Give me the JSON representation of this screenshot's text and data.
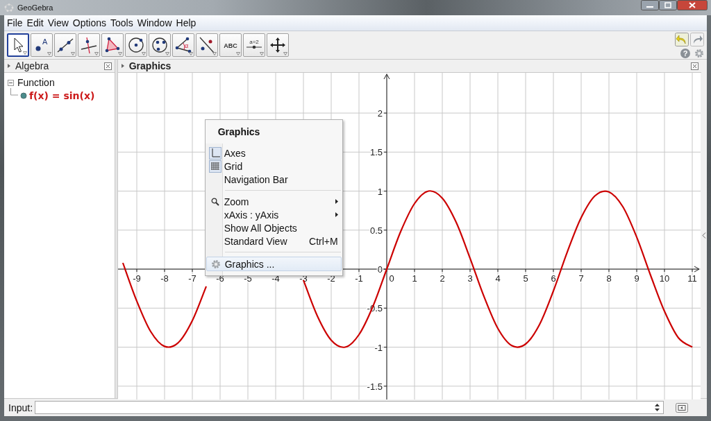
{
  "window": {
    "title": "GeoGebra"
  },
  "menu_bar": [
    "File",
    "Edit",
    "View",
    "Options",
    "Tools",
    "Window",
    "Help"
  ],
  "toolbar": {
    "tools": [
      {
        "kind": "move",
        "selected": true
      },
      {
        "kind": "point",
        "label": "A",
        "selected": false
      },
      {
        "kind": "line",
        "selected": false
      },
      {
        "kind": "perpendicular",
        "selected": false
      },
      {
        "kind": "polygon",
        "selected": false
      },
      {
        "kind": "circle",
        "selected": false
      },
      {
        "kind": "circle3",
        "selected": false
      },
      {
        "kind": "angle",
        "label": "α",
        "selected": false
      },
      {
        "kind": "reflect",
        "selected": false
      },
      {
        "kind": "text",
        "label": "ABC",
        "selected": false
      },
      {
        "kind": "slider",
        "label": "a=2",
        "selected": false
      },
      {
        "kind": "pan",
        "selected": false
      }
    ],
    "help": "?"
  },
  "algebra": {
    "title": "Algebra",
    "tree": [
      {
        "label": "Function",
        "expanded": true,
        "children": [
          {
            "label": "f(x) = sin(x)",
            "visible": true
          }
        ]
      }
    ]
  },
  "graphics": {
    "title": "Graphics",
    "chart_data": {
      "type": "line",
      "x": [
        -9.5,
        -9,
        -8.5,
        -8,
        -7.5,
        -7,
        -6.5,
        -6,
        -5.5,
        -5,
        -4.5,
        -4,
        -3.5,
        -3,
        -2.5,
        -2,
        -1.5,
        -1,
        -0.5,
        0,
        0.5,
        1,
        1.5,
        2,
        2.5,
        3,
        3.5,
        4,
        4.5,
        5,
        5.5,
        6,
        6.5,
        7,
        7.5,
        8,
        8.5,
        9,
        9.5,
        10,
        10.5,
        11
      ],
      "series": [
        {
          "color": "#cc0000",
          "values": [
            0.08,
            -0.41,
            -0.8,
            -0.99,
            -0.94,
            -0.66,
            -0.22,
            null,
            null,
            null,
            null,
            null,
            null,
            -0.14,
            -0.6,
            -0.91,
            -1,
            -0.84,
            -0.48,
            0,
            0.48,
            0.84,
            1,
            0.91,
            0.6,
            0.14,
            -0.35,
            -0.76,
            -0.98,
            -0.96,
            -0.71,
            -0.28,
            0.22,
            0.66,
            0.94,
            0.99,
            0.8,
            0.41,
            -0.08,
            -0.54,
            -0.88,
            -1
          ]
        }
      ],
      "xlim": [
        -9.675,
        11.3
      ],
      "ylim": [
        -1.671,
        2.516
      ],
      "xticks": [
        -9,
        -8,
        -7,
        -6,
        -5,
        -4,
        -3,
        -2,
        -1,
        0,
        1,
        2,
        3,
        4,
        5,
        6,
        7,
        8,
        9,
        10,
        11
      ],
      "yticks": [
        -1.5,
        -1,
        -0.5,
        0,
        0.5,
        1,
        1.5,
        2
      ],
      "grid": true
    },
    "context_menu": {
      "title": "Graphics",
      "sections": [
        [
          {
            "kind": "toggle",
            "label": "Axes",
            "checked": true,
            "highlighted": false
          },
          {
            "kind": "toggle",
            "label": "Grid",
            "checked": true,
            "highlighted": false
          },
          {
            "kind": "toggle",
            "label": "Navigation Bar",
            "checked": false,
            "highlighted": false
          }
        ],
        [
          {
            "kind": "submenu",
            "label": "Zoom",
            "highlighted": false
          },
          {
            "kind": "submenu",
            "label": "xAxis : yAxis",
            "highlighted": false
          },
          {
            "kind": "action",
            "label": "Show All Objects",
            "highlighted": false
          },
          {
            "kind": "action",
            "label": "Standard View",
            "shortcut": "Ctrl+M",
            "highlighted": false
          }
        ],
        [
          {
            "kind": "action",
            "label": "Graphics ...",
            "highlighted": true
          }
        ]
      ]
    }
  },
  "input_bar": {
    "label": "Input:"
  }
}
